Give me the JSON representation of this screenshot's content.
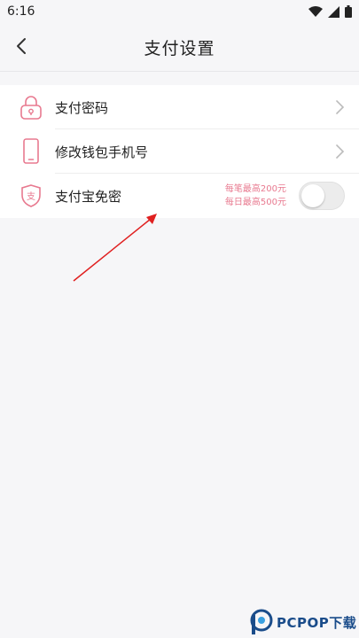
{
  "status_bar": {
    "time": "6:16"
  },
  "header": {
    "title": "支付设置"
  },
  "settings": {
    "items": [
      {
        "label": "支付密码",
        "icon": "lock-icon"
      },
      {
        "label": "修改钱包手机号",
        "icon": "phone-icon"
      },
      {
        "label": "支付宝免密",
        "icon": "alipay-shield-icon",
        "limit_per_transaction": "每笔最高200元",
        "limit_per_day": "每日最高500元",
        "toggle_on": false
      }
    ]
  },
  "colors": {
    "accent": "#e8798f",
    "background": "#f6f6f8",
    "annotation_arrow": "#e02020"
  },
  "watermark": {
    "brand": "PCPOP下载"
  }
}
